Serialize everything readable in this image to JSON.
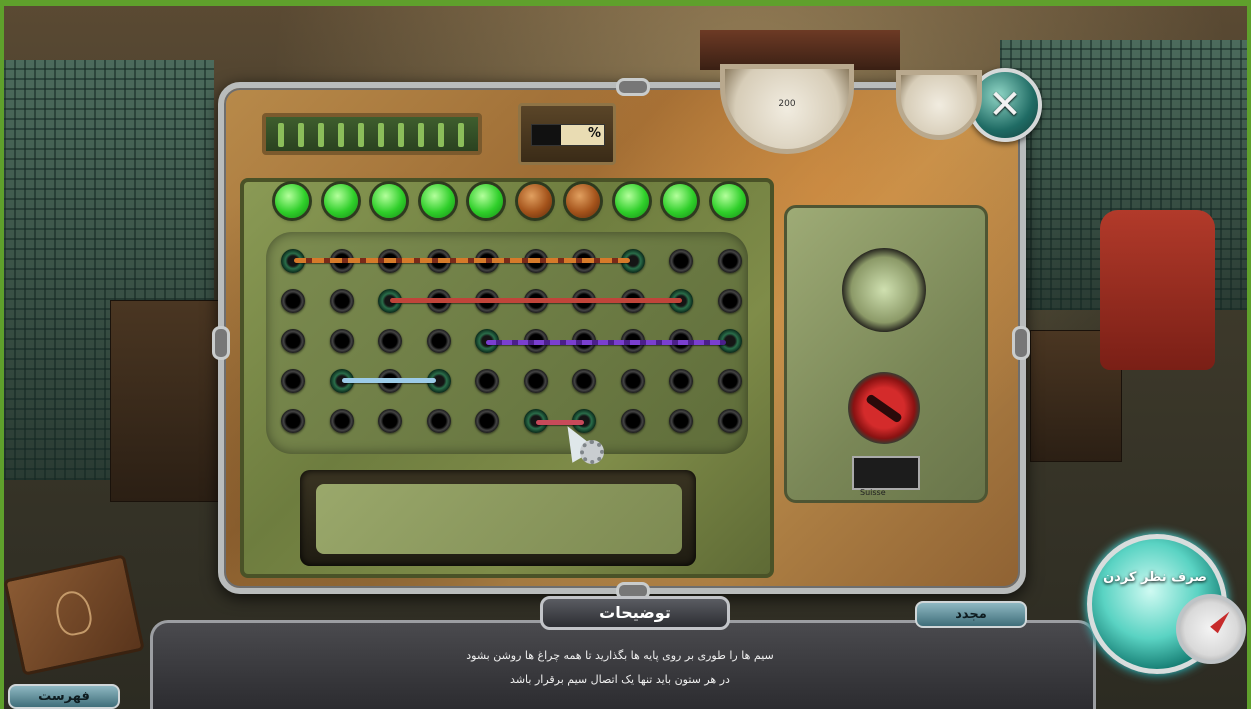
{
  "panel": {
    "percent_symbol": "%",
    "progress_fraction": 0.6,
    "close_icon": "close-icon"
  },
  "gauges": [
    "200"
  ],
  "lamps": [
    "on",
    "on",
    "on",
    "on",
    "on",
    "off",
    "off",
    "on",
    "on",
    "on"
  ],
  "switch_plate": {
    "brand": "Suisse"
  },
  "hud": {
    "description_tab": "توضیحات",
    "reset_button": "مجدد",
    "menu_button": "فهرست",
    "skip_button": "صرف نظر کردن",
    "instructions": [
      "سیم ها را طوری بر روی پایه ها بگذارید تا همه چراغ ها روشن بشود",
      "در هر ستون باید تنها یک اتصال سیم برقرار باشد"
    ]
  },
  "colors": {
    "lamp_on": "#2fcf2a",
    "lamp_off": "#a4531b",
    "wire_orange": "#d67a2a",
    "wire_red": "#c0443a",
    "wire_purple": "#7a3fcf",
    "wire_blue": "#9ccbe8",
    "wire_pink": "#c84a5a"
  }
}
